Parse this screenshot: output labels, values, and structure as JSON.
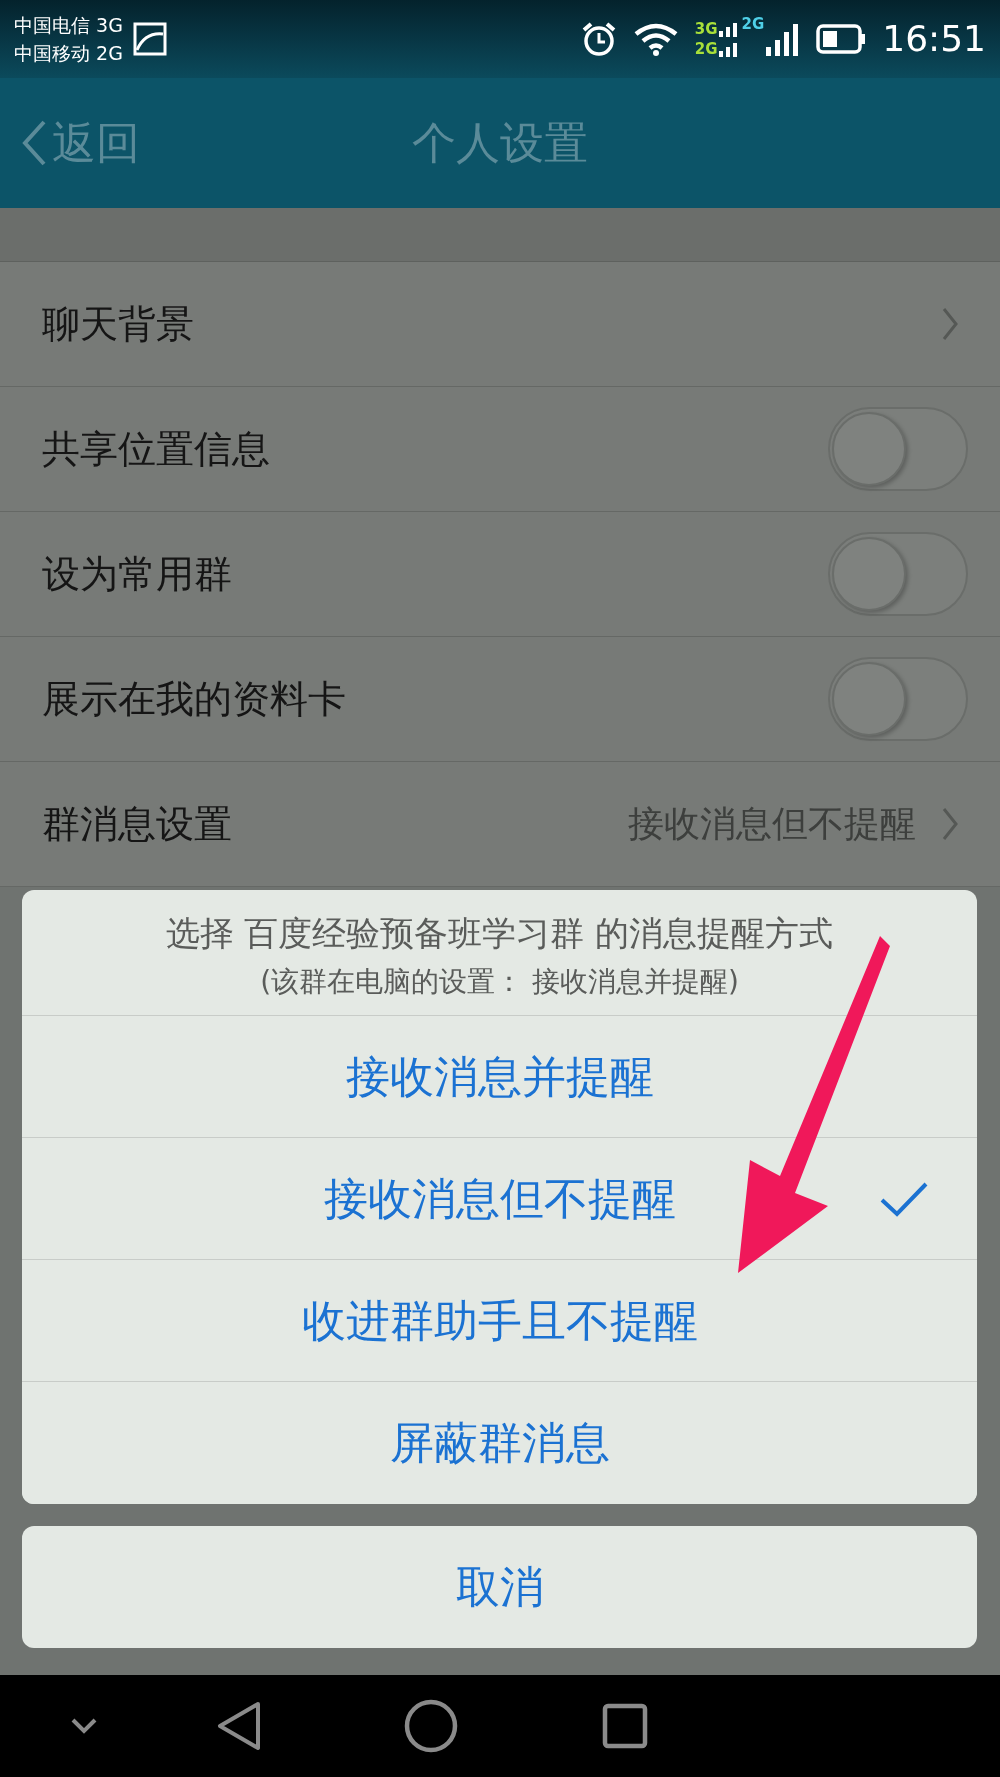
{
  "status_bar": {
    "carriers": [
      "中国电信 3G",
      "中国移动 2G"
    ],
    "network_labels": [
      "3G",
      "2G",
      "2G"
    ],
    "time": "16:51"
  },
  "header": {
    "back": "返回",
    "title": "个人设置"
  },
  "settings": [
    {
      "kind": "chevron",
      "label": "聊天背景"
    },
    {
      "kind": "toggle",
      "label": "共享位置信息",
      "on": false
    },
    {
      "kind": "toggle",
      "label": "设为常用群",
      "on": false
    },
    {
      "kind": "toggle",
      "label": "展示在我的资料卡",
      "on": false
    },
    {
      "kind": "value",
      "label": "群消息设置",
      "value": "接收消息但不提醒"
    }
  ],
  "action_sheet": {
    "title": "选择 百度经验预备班学习群 的消息提醒方式",
    "subtitle": "(该群在电脑的设置： 接收消息并提醒)",
    "options": [
      {
        "label": "接收消息并提醒",
        "selected": false
      },
      {
        "label": "接收消息但不提醒",
        "selected": true
      },
      {
        "label": "收进群助手且不提醒",
        "selected": false
      },
      {
        "label": "屏蔽群消息",
        "selected": false
      }
    ],
    "cancel": "取消"
  }
}
